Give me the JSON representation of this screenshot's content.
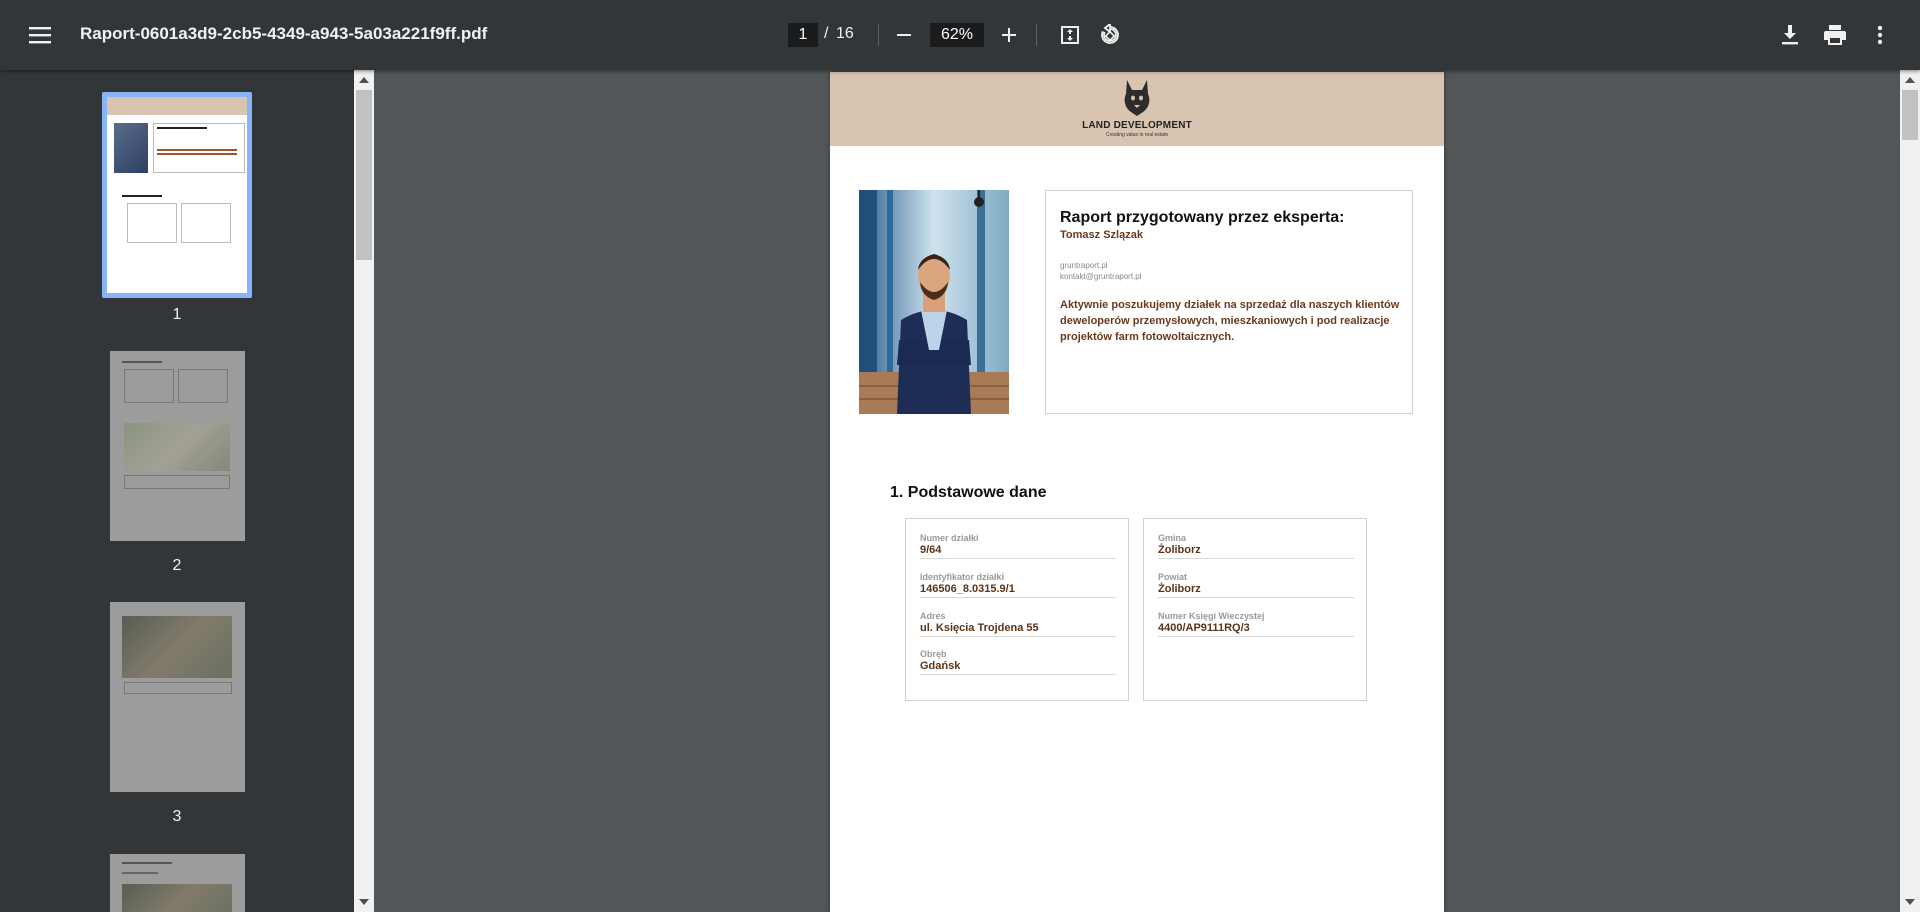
{
  "toolbar": {
    "title": "Raport-0601a3d9-2cb5-4349-a943-5a03a221f9ff.pdf",
    "current_page": "1",
    "page_separator": "/",
    "total_pages": "16",
    "zoom": "62%",
    "icons": {
      "menu": "menu-icon",
      "zoom_out": "minus-icon",
      "zoom_in": "plus-icon",
      "fit": "fit-page-icon",
      "rotate": "rotate-icon",
      "download": "download-icon",
      "print": "print-icon",
      "more": "more-vert-icon"
    }
  },
  "sidebar": {
    "thumbnails": [
      {
        "number": "1"
      },
      {
        "number": "2"
      },
      {
        "number": "3"
      },
      {
        "number": ""
      }
    ]
  },
  "page": {
    "header": {
      "brand": "LAND DEVELOPMENT",
      "tagline": "Creating value in real estate"
    },
    "expert": {
      "title": "Raport przygotowany przez eksperta:",
      "name": "Tomasz Szlązak",
      "website": "gruntraport.pl",
      "email": "kontakt@gruntraport.pl",
      "description": "Aktywnie poszukujemy działek na sprzedaż dla naszych klientów deweloperów przemysłowych, mieszkaniowych i pod realizacje projektów farm fotowoltaicznych."
    },
    "section": {
      "title": "1. Podstawowe dane",
      "left_fields": [
        {
          "label": "Numer działki",
          "value": "9/64"
        },
        {
          "label": "Identyfikator działki",
          "value": "146506_8.0315.9/1"
        },
        {
          "label": "Adres",
          "value": "ul. Księcia Trojdena 55"
        },
        {
          "label": "Obręb",
          "value": "Gdańsk"
        }
      ],
      "right_fields": [
        {
          "label": "Gmina",
          "value": "Żoliborz"
        },
        {
          "label": "Powiat",
          "value": "Żoliborz"
        },
        {
          "label": "Numer Księgi Wieczystej",
          "value": "4400/AP9111RQ/3"
        }
      ]
    }
  },
  "colors": {
    "toolbar_bg": "#323639",
    "viewer_bg": "#525659",
    "header_band": "#d9c4b1",
    "accent_text": "#5c3317",
    "active_thumb_border": "#8ab4f8"
  }
}
